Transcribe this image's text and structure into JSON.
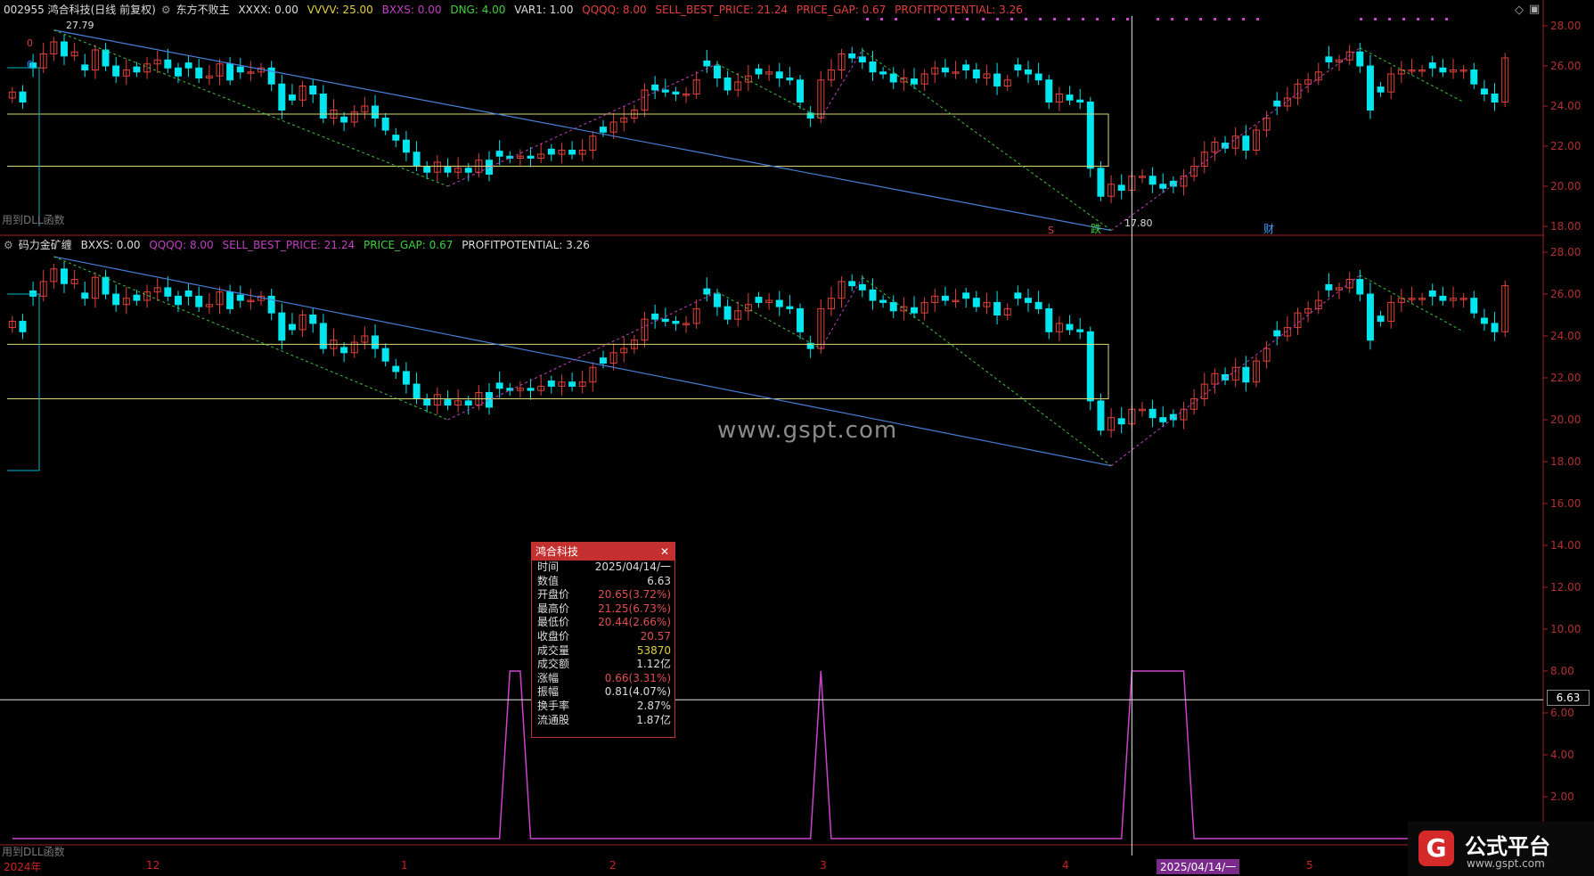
{
  "header1": {
    "code_name": "002955 鸿合科技(日线 前复权)",
    "indicator": "东方不败主",
    "xxxx": "XXXX: 0.00",
    "vvvv": "VVVV: 25.00",
    "bxxs": "BXXS: 0.00",
    "dng": "DNG: 4.00",
    "var1": "VAR1: 1.00",
    "qqqq": "QQQQ: 8.00",
    "sbp": "SELL_BEST_PRICE: 21.24",
    "gap": "PRICE_GAP: 0.67",
    "pp": "PROFITPOTENTIAL: 3.26"
  },
  "header2": {
    "indicator": "码力金矿缠",
    "bxxs": "BXXS: 0.00",
    "qqqq": "QQQQ: 8.00",
    "sbp": "SELL_BEST_PRICE: 21.24",
    "gap": "PRICE_GAP: 0.67",
    "pp": "PROFITPOTENTIAL: 3.26"
  },
  "dll_label": "用到DLL函数",
  "watermark": "www.gspt.com",
  "annotations": {
    "high": "27.79",
    "low": "17.80",
    "sig_s": "S",
    "sig_die": "跌",
    "sig_cai": "财",
    "zero1": "0",
    "zero2": "0"
  },
  "x_labels": [
    "2024年",
    "12",
    "1",
    "2",
    "3",
    "4",
    "5"
  ],
  "cursor_date": "2025/04/14/一",
  "value_tag": "6.63",
  "tooltip": {
    "title": "鸿合科技",
    "rows": [
      {
        "label": "时间",
        "value": "2025/04/14/一",
        "color": "#dddddd"
      },
      {
        "label": "数值",
        "value": "6.63",
        "color": "#dddddd"
      },
      {
        "label": "开盘价",
        "value": "20.65(3.72%)",
        "color": "#e05050"
      },
      {
        "label": "最高价",
        "value": "21.25(6.73%)",
        "color": "#e05050"
      },
      {
        "label": "最低价",
        "value": "20.44(2.66%)",
        "color": "#e05050"
      },
      {
        "label": "收盘价",
        "value": "20.57",
        "color": "#e05050"
      },
      {
        "label": "成交量",
        "value": "53870",
        "color": "#e0d040"
      },
      {
        "label": "成交额",
        "value": "1.12亿",
        "color": "#dddddd"
      },
      {
        "label": "涨幅",
        "value": "0.66(3.31%)",
        "color": "#e05050"
      },
      {
        "label": "振幅",
        "value": "0.81(4.07%)",
        "color": "#dddddd"
      },
      {
        "label": "换手率",
        "value": "2.87%",
        "color": "#dddddd"
      },
      {
        "label": "流通股",
        "value": "1.87亿",
        "color": "#dddddd"
      }
    ]
  },
  "brand": {
    "name": "公式平台",
    "url": "www.gspt.com",
    "logo": "G"
  },
  "colors": {
    "up": "#e0413a",
    "down": "#00e5ee",
    "axis": "#a52020",
    "magenta": "#cc44cc",
    "hline": "#d8d87a",
    "trend": "#4a7fd8"
  },
  "chart_data": {
    "type": "candlestick",
    "y_ticks": [
      "28.00",
      "26.00",
      "24.00",
      "22.00",
      "20.00",
      "18.00",
      "16.00",
      "14.00",
      "12.00",
      "10.00",
      "8.00",
      "6.00",
      "4.00",
      "2.00"
    ],
    "close": [
      24.7,
      24.2,
      25.9,
      26.6,
      27.2,
      26.5,
      26.7,
      25.8,
      26.8,
      26.0,
      25.5,
      25.8,
      25.7,
      26.1,
      26.3,
      25.9,
      25.5,
      25.9,
      25.4,
      25.5,
      26.1,
      25.3,
      25.7,
      25.7,
      25.9,
      25.1,
      23.8,
      24.3,
      25.0,
      24.6,
      23.4,
      23.8,
      23.2,
      23.7,
      24.0,
      23.4,
      22.8,
      22.3,
      21.7,
      21.0,
      20.7,
      21.2,
      20.7,
      20.9,
      20.7,
      21.3,
      20.6,
      21.5,
      21.4,
      21.5,
      21.4,
      21.6,
      21.6,
      21.8,
      21.6,
      21.8,
      22.5,
      22.7,
      23.2,
      23.4,
      23.8,
      24.8,
      24.8,
      24.7,
      24.6,
      24.6,
      25.3,
      26.0,
      25.4,
      24.8,
      25.2,
      25.5,
      25.6,
      25.7,
      25.4,
      25.3,
      24.2,
      23.4,
      25.3,
      25.8,
      26.6,
      26.4,
      26.2,
      25.7,
      25.6,
      25.2,
      25.4,
      25.1,
      25.6,
      25.9,
      25.7,
      25.7,
      25.8,
      25.4,
      25.6,
      25.0,
      25.3,
      25.8,
      25.6,
      25.3,
      24.2,
      24.6,
      24.3,
      24.2,
      20.9,
      19.5,
      20.1,
      19.8,
      20.5,
      20.5,
      20.1,
      19.9,
      20.0,
      20.5,
      21.0,
      21.7,
      22.2,
      21.9,
      22.5,
      21.8,
      22.8,
      23.4,
      24.0,
      24.4,
      25.1,
      25.3,
      25.7,
      26.2,
      26.3,
      26.7,
      26.0,
      23.8,
      24.7,
      25.6,
      25.8,
      25.8,
      25.8,
      25.9,
      25.7,
      25.8,
      25.8,
      25.1,
      24.6,
      24.2,
      26.4
    ],
    "values_panel": [
      0,
      0,
      0,
      0,
      0,
      0,
      0,
      0,
      0,
      0,
      0,
      0,
      0,
      0,
      0,
      0,
      0,
      0,
      0,
      0,
      0,
      0,
      0,
      0,
      0,
      0,
      0,
      0,
      0,
      0,
      0,
      0,
      0,
      0,
      0,
      0,
      0,
      0,
      0,
      0,
      0,
      0,
      0,
      0,
      0,
      0,
      0,
      0,
      8,
      8,
      0,
      0,
      0,
      0,
      0,
      0,
      0,
      0,
      0,
      0,
      0,
      0,
      0,
      0,
      0,
      0,
      0,
      0,
      0,
      0,
      0,
      0,
      0,
      0,
      0,
      0,
      0,
      0,
      8,
      0,
      0,
      0,
      0,
      0,
      0,
      0,
      0,
      0,
      0,
      0,
      0,
      0,
      0,
      0,
      0,
      0,
      0,
      0,
      0,
      0,
      0,
      0,
      0,
      0,
      0,
      0,
      0,
      0,
      8,
      8,
      8,
      8,
      8,
      8,
      0,
      0,
      0,
      0,
      0,
      0,
      0,
      0,
      0,
      0,
      0,
      0,
      0,
      0,
      0,
      0,
      0,
      0,
      0,
      0,
      0,
      0,
      0,
      0,
      0,
      0,
      0,
      0,
      0,
      0,
      0
    ],
    "cursor_index": 108,
    "cursor_value": 6.63,
    "support_levels": [
      23.6,
      21.0
    ],
    "extremes": {
      "high": 27.79,
      "low": 17.8
    }
  }
}
